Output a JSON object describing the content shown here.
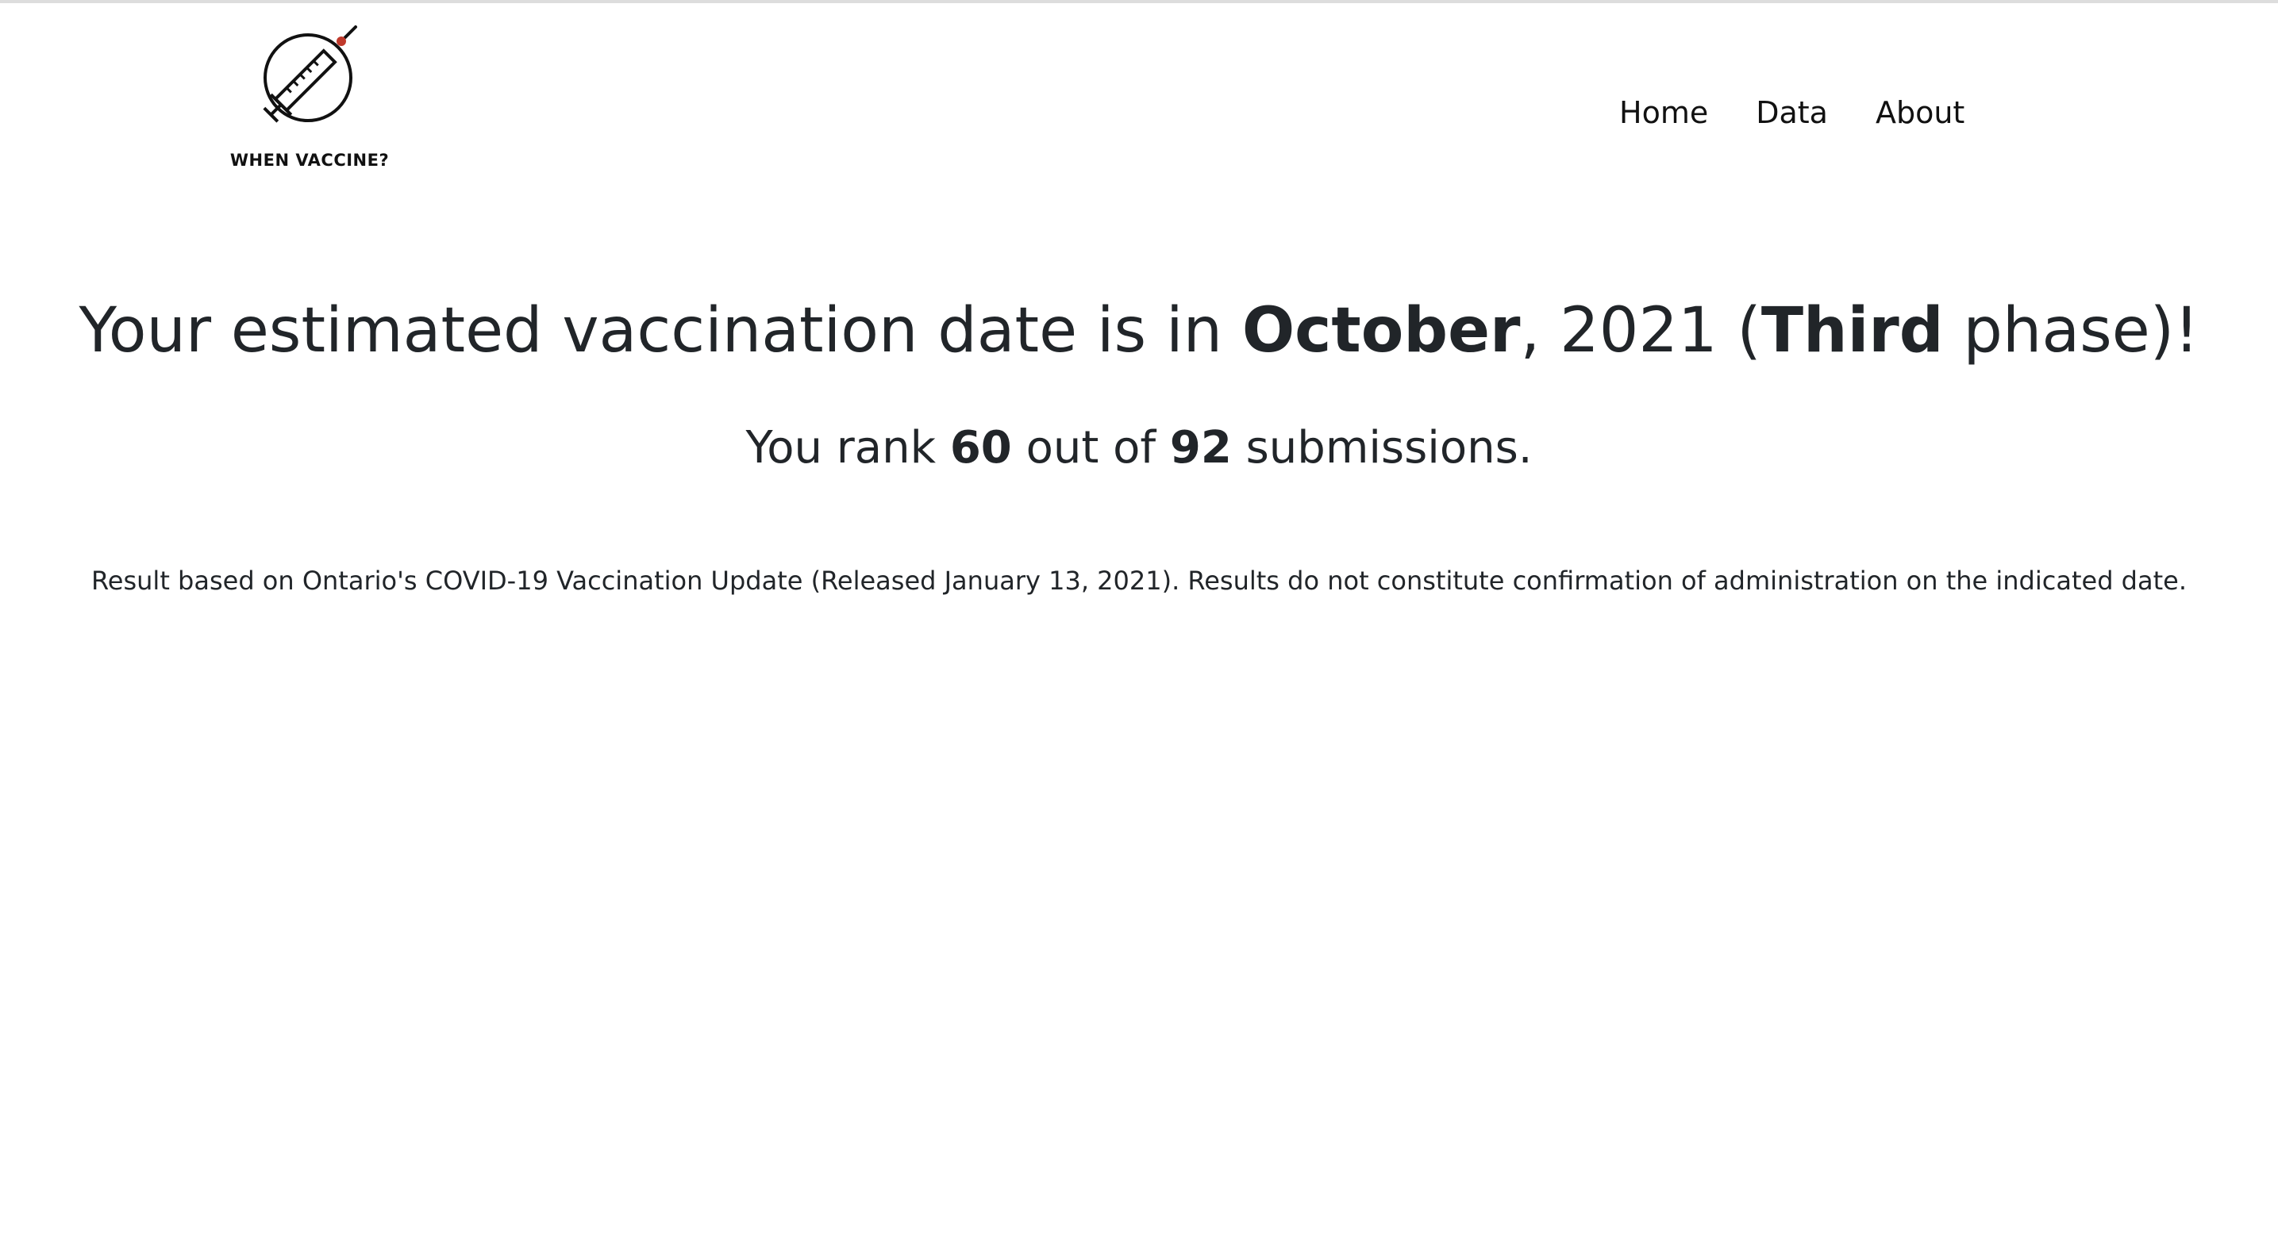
{
  "brand": {
    "name": "WHEN VACCINE?",
    "logo_icon": "syringe-in-circle-icon",
    "accent_color": "#c0392b"
  },
  "nav": {
    "items": [
      {
        "label": "Home"
      },
      {
        "label": "Data"
      },
      {
        "label": "About"
      }
    ]
  },
  "result": {
    "prefix": "Your estimated vaccination date is in ",
    "month": "October",
    "year_part": ", 2021 (",
    "phase": "Third",
    "suffix": " phase)!"
  },
  "rank": {
    "prefix": "You rank ",
    "position": "60",
    "middle": " out of ",
    "total": "92",
    "suffix": " submissions."
  },
  "disclaimer": "Result based on Ontario's COVID-19 Vaccination Update (Released January 13, 2021). Results do not constitute confirmation of administration on the indicated date."
}
